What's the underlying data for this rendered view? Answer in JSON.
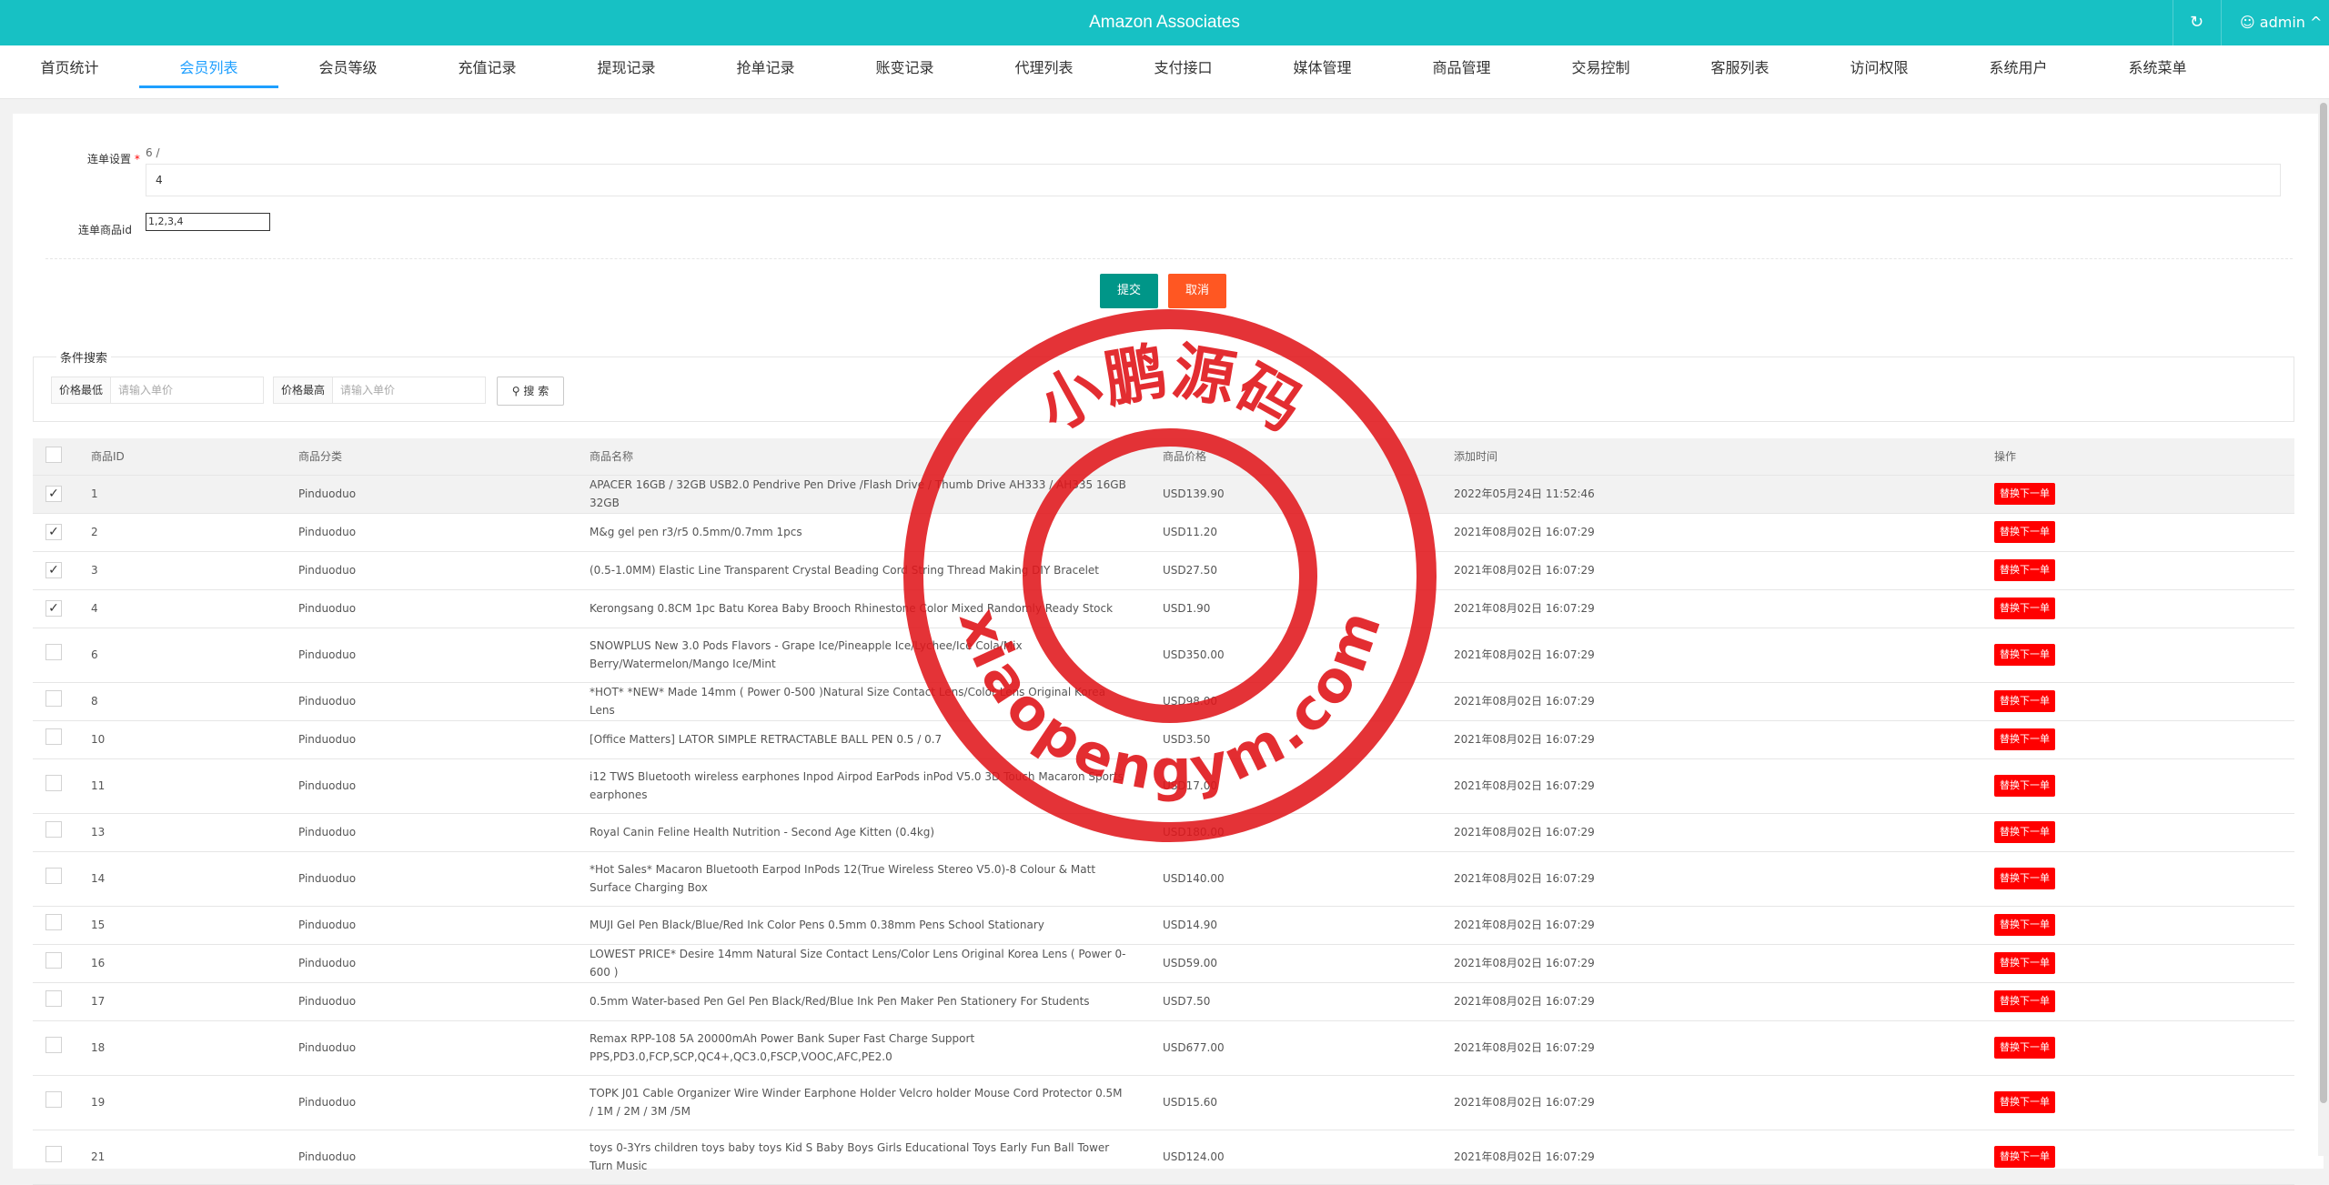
{
  "header": {
    "title": "Amazon Associates",
    "refresh_icon": "↻",
    "user": "admin ^"
  },
  "nav": {
    "items": [
      {
        "label": "首页统计"
      },
      {
        "label": "会员列表"
      },
      {
        "label": "会员等级"
      },
      {
        "label": "充值记录"
      },
      {
        "label": "提现记录"
      },
      {
        "label": "抢单记录"
      },
      {
        "label": "账变记录"
      },
      {
        "label": "代理列表"
      },
      {
        "label": "支付接口"
      },
      {
        "label": "媒体管理"
      },
      {
        "label": "商品管理"
      },
      {
        "label": "交易控制"
      },
      {
        "label": "客服列表"
      },
      {
        "label": "访问权限"
      },
      {
        "label": "系统用户"
      },
      {
        "label": "系统菜单"
      }
    ],
    "active_index": 1
  },
  "form": {
    "lian_dan_label": "连单设置",
    "required_mark": "*",
    "lian_dan_hint": "6 /",
    "lian_dan_value": "4",
    "goods_id_label": "连单商品id",
    "goods_id_value": "1,2,3,4",
    "submit": "提交",
    "cancel": "取消"
  },
  "search": {
    "legend": "条件搜索",
    "min_label": "价格最低",
    "min_placeholder": "请输入单价",
    "max_label": "价格最高",
    "max_placeholder": "请输入单价",
    "button": "搜 索"
  },
  "table": {
    "headers": [
      "商品ID",
      "商品分类",
      "商品名称",
      "商品价格",
      "添加时间",
      "操作"
    ],
    "op_label": "替换下一单",
    "rows": [
      {
        "id": "1",
        "cat": "Pinduoduo",
        "name": "APACER 16GB / 32GB USB2.0 Pendrive Pen Drive /Flash Drive / Thumb Drive AH333 / AH335 16GB 32GB",
        "price": "USD139.90",
        "time": "2022年05月24日 11:52:46",
        "checked": true,
        "tall": false
      },
      {
        "id": "2",
        "cat": "Pinduoduo",
        "name": "M&g gel pen r3/r5 0.5mm/0.7mm 1pcs",
        "price": "USD11.20",
        "time": "2021年08月02日 16:07:29",
        "checked": true,
        "tall": false
      },
      {
        "id": "3",
        "cat": "Pinduoduo",
        "name": "(0.5-1.0MM) Elastic Line Transparent Crystal Beading Cord String Thread Making DIY Bracelet",
        "price": "USD27.50",
        "time": "2021年08月02日 16:07:29",
        "checked": true,
        "tall": false
      },
      {
        "id": "4",
        "cat": "Pinduoduo",
        "name": "Kerongsang 0.8CM 1pc Batu Korea Baby Brooch Rhinestone Color Mixed Randomly Ready Stock",
        "price": "USD1.90",
        "time": "2021年08月02日 16:07:29",
        "checked": true,
        "tall": false
      },
      {
        "id": "6",
        "cat": "Pinduoduo",
        "name": "SNOWPLUS New 3.0 Pods Flavors - Grape Ice/Pineapple Ice/Lychee/Ice Cola/Mix Berry/Watermelon/Mango Ice/Mint",
        "price": "USD350.00",
        "time": "2021年08月02日 16:07:29",
        "checked": false,
        "tall": true
      },
      {
        "id": "8",
        "cat": "Pinduoduo",
        "name": "*HOT* *NEW* Made 14mm ( Power 0-500 )Natural Size Contact Lens/Color Lens Original Korea Lens",
        "price": "USD98.00",
        "time": "2021年08月02日 16:07:29",
        "checked": false,
        "tall": false
      },
      {
        "id": "10",
        "cat": "Pinduoduo",
        "name": "[Office Matters] LATOR SIMPLE RETRACTABLE BALL PEN 0.5 / 0.7",
        "price": "USD3.50",
        "time": "2021年08月02日 16:07:29",
        "checked": false,
        "tall": false
      },
      {
        "id": "11",
        "cat": "Pinduoduo",
        "name": "i12 TWS Bluetooth wireless earphones Inpod Airpod EarPods inPod V5.0 3D Touch Macaron Sports earphones",
        "price": "USD17.00",
        "time": "2021年08月02日 16:07:29",
        "checked": false,
        "tall": true
      },
      {
        "id": "13",
        "cat": "Pinduoduo",
        "name": "Royal Canin Feline Health Nutrition - Second Age Kitten (0.4kg)",
        "price": "USD180.00",
        "time": "2021年08月02日 16:07:29",
        "checked": false,
        "tall": false
      },
      {
        "id": "14",
        "cat": "Pinduoduo",
        "name": "*Hot Sales* Macaron Bluetooth Earpod InPods 12(True Wireless Stereo V5.0)-8 Colour & Matt Surface Charging Box",
        "price": "USD140.00",
        "time": "2021年08月02日 16:07:29",
        "checked": false,
        "tall": true
      },
      {
        "id": "15",
        "cat": "Pinduoduo",
        "name": "MUJI Gel Pen Black/Blue/Red Ink Color Pens 0.5mm 0.38mm Pens School Stationary",
        "price": "USD14.90",
        "time": "2021年08月02日 16:07:29",
        "checked": false,
        "tall": false
      },
      {
        "id": "16",
        "cat": "Pinduoduo",
        "name": "LOWEST PRICE* Desire 14mm Natural Size Contact Lens/Color Lens Original Korea Lens ( Power 0-600 )",
        "price": "USD59.00",
        "time": "2021年08月02日 16:07:29",
        "checked": false,
        "tall": false
      },
      {
        "id": "17",
        "cat": "Pinduoduo",
        "name": "0.5mm Water-based Pen Gel Pen Black/Red/Blue Ink Pen Maker Pen Stationery For Students",
        "price": "USD7.50",
        "time": "2021年08月02日 16:07:29",
        "checked": false,
        "tall": false
      },
      {
        "id": "18",
        "cat": "Pinduoduo",
        "name": "Remax RPP-108 5A 20000mAh Power Bank Super Fast Charge Support PPS,PD3.0,FCP,SCP,QC4+,QC3.0,FSCP,VOOC,AFC,PE2.0",
        "price": "USD677.00",
        "time": "2021年08月02日 16:07:29",
        "checked": false,
        "tall": true
      },
      {
        "id": "19",
        "cat": "Pinduoduo",
        "name": "TOPK J01 Cable Organizer Wire Winder Earphone Holder Velcro holder Mouse Cord Protector 0.5M / 1M / 2M / 3M /5M",
        "price": "USD15.60",
        "time": "2021年08月02日 16:07:29",
        "checked": false,
        "tall": true
      },
      {
        "id": "21",
        "cat": "Pinduoduo",
        "name": "toys 0-3Yrs children toys baby toys Kid S Baby Boys Girls Educational Toys Early Fun Ball Tower Turn Music",
        "price": "USD124.00",
        "time": "2021年08月02日 16:07:29",
        "checked": false,
        "tall": true
      }
    ]
  },
  "watermark": {
    "cn": "小鹏源码",
    "url": "xiaopengym.com"
  },
  "colors": {
    "header_bg": "#17c1c4",
    "active_nav": "#1e9fff",
    "submit": "#009688",
    "cancel": "#ff5722",
    "op": "#ff0000",
    "stamp": "#e0171b"
  }
}
